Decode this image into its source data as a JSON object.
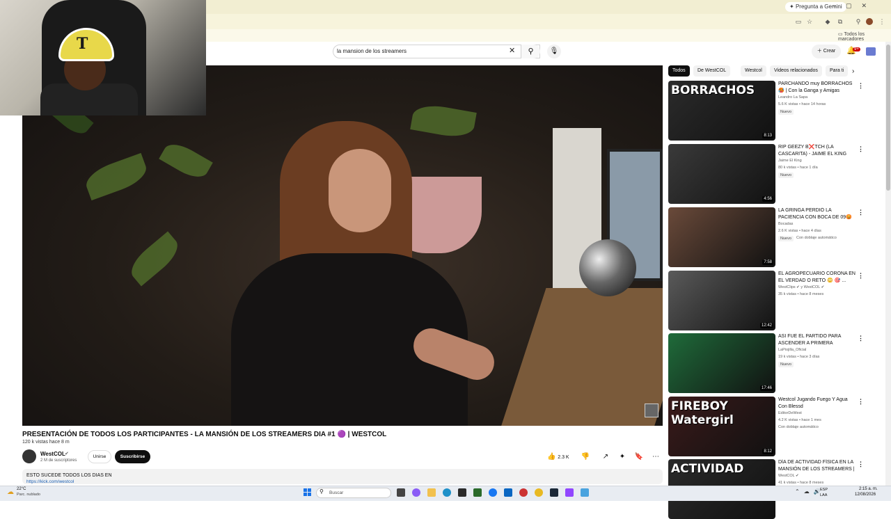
{
  "browser": {
    "gemini_button": "Pregunta a Gemini",
    "bookmarks_label": "Todos los marcadores"
  },
  "header": {
    "search_query": "la mansion de los streamers",
    "create_label": "Crear",
    "notifications_count": "9+"
  },
  "video": {
    "title": "PRESENTACIÓN DE TODOS LOS PARTICIPANTES - LA MANSIÓN DE LOS STREAMERS DIA #1 🟣 | WESTCOL",
    "meta": "120 k vistas  hace 8 m",
    "channel_name": "WestCOL",
    "channel_subs": "2 M de suscriptores",
    "join_label": "Unirse",
    "subscribe_label": "Suscribirse",
    "likes": "2.3 K",
    "description_line": "ESTO SUCEDE TODOS LOS DIAS EN",
    "description_link": "https://kick.com/westcol"
  },
  "chips": [
    "Todos",
    "De WestCOL",
    "Westcol",
    "Videos relacionados",
    "Para ti"
  ],
  "recommendations": [
    {
      "title": "PARCHANDO muy BORRACHOS 🥵 | Con la Ganga y Amigas",
      "channel": "Leandro La Sapa",
      "stats": "5.6 K vistas • hace 14 horas",
      "badge": "Nuevo",
      "dub": "",
      "duration": "8:13",
      "thumb_text": "BORRACHOS",
      "thumb_color": "#2b2b2b"
    },
    {
      "title": "RIP GEEZY B❌TCH (LA CASCARITA) - JAIME EL KING",
      "channel": "Jaime El King",
      "stats": "80 k vistas • hace 1 día",
      "badge": "Nuevo",
      "dub": "",
      "duration": "4:56",
      "thumb_text": "",
      "thumb_color": "#3a3a3a"
    },
    {
      "title": "LA GRINGA PERDIÓ LA PACIENCIA CON BOCA DE 09😡",
      "channel": "Bocadas",
      "stats": "2.6 K vistas • hace 4 días",
      "badge": "Nuevo",
      "dub": "Con doblaje automático",
      "duration": "7:58",
      "thumb_text": "",
      "thumb_color": "#6a4a3a"
    },
    {
      "title": "EL AGROPECUARIO CORONA EN EL VERDAD O RETO 😳 🎯 ...",
      "channel": "WestClips ✔ y WestCOL ✔",
      "stats": "35 k vistas • hace 8 meses",
      "badge": "",
      "dub": "",
      "duration": "12:42",
      "thumb_text": "",
      "thumb_color": "#5a5a5a"
    },
    {
      "title": "ASI FUE EL PARTIDO PARA ASCENDER A PRIMERA DIVISION...",
      "channel": "LaPiojilla_Oficial",
      "stats": "19 k vistas • hace 3 días",
      "badge": "Nuevo",
      "dub": "",
      "duration": "17:46",
      "thumb_text": "",
      "thumb_color": "#1f6b3a"
    },
    {
      "title": "Westcol Jugando Fuego Y Agua Con Blessd",
      "channel": "EditorDeWest",
      "stats": "4.2 K vistas • hace 1 mes",
      "badge": "",
      "dub": "Con doblaje automático",
      "duration": "8:12",
      "thumb_text": "FIREBOY Watergirl",
      "thumb_color": "#3a1a1a"
    },
    {
      "title": "DÍA DE ACTIVIDAD FÍSICA EN LA MANSIÓN DE LOS STREAMERS | ...",
      "channel": "WestCOL ✔",
      "stats": "41 k vistas • hace 8 meses",
      "badge": "",
      "dub": "",
      "duration": "",
      "thumb_text": "ACTIVIDAD",
      "thumb_color": "#2a2a2a"
    }
  ],
  "taskbar": {
    "weather_temp": "22°C",
    "weather_desc": "Parc. nublado",
    "search_placeholder": "Buscar",
    "lang1": "ESP",
    "lang2": "LAA",
    "time": "2:15 a. m.",
    "date": "12/08/2026"
  }
}
